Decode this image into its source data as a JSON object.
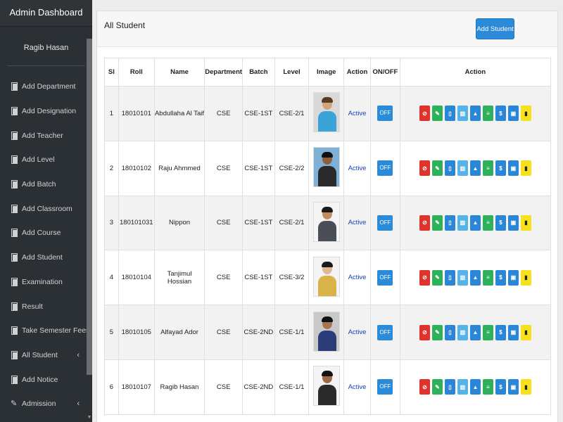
{
  "sidebar": {
    "title": "Admin Dashboard",
    "user": "Ragib Hasan",
    "items": [
      {
        "label": "Add Department",
        "icon": "doc-icon"
      },
      {
        "label": "Add Designation",
        "icon": "doc-icon"
      },
      {
        "label": "Add Teacher",
        "icon": "doc-icon"
      },
      {
        "label": "Add Level",
        "icon": "doc-icon"
      },
      {
        "label": "Add Batch",
        "icon": "doc-icon"
      },
      {
        "label": "Add Classroom",
        "icon": "doc-icon"
      },
      {
        "label": "Add Course",
        "icon": "doc-icon"
      },
      {
        "label": "Add Student",
        "icon": "doc-icon"
      },
      {
        "label": "Examination",
        "icon": "doc-icon"
      },
      {
        "label": "Result",
        "icon": "doc-icon"
      },
      {
        "label": "Take Semester Fees",
        "icon": "doc-icon"
      },
      {
        "label": "All Student",
        "icon": "doc-icon",
        "chevron": "‹"
      },
      {
        "label": "Add Notice",
        "icon": "doc-icon"
      },
      {
        "label": "Admission",
        "icon": "edit-icon",
        "chevron": "‹"
      }
    ]
  },
  "main": {
    "title": "All Student",
    "add_button": "Add Student"
  },
  "table": {
    "headers": [
      "Sl",
      "Roll",
      "Name",
      "Department",
      "Batch",
      "Level",
      "Image",
      "Action",
      "ON/OFF",
      "Action"
    ],
    "rows": [
      {
        "sl": "1",
        "roll": "18010101",
        "name": "Abdullaha Al Taif",
        "dept": "CSE",
        "batch": "CSE-1ST",
        "level": "CSE-2/1",
        "status": "Active",
        "toggle": "OFF"
      },
      {
        "sl": "2",
        "roll": "18010102",
        "name": "Raju Ahmmed",
        "dept": "CSE",
        "batch": "CSE-1ST",
        "level": "CSE-2/2",
        "status": "Active",
        "toggle": "OFF"
      },
      {
        "sl": "3",
        "roll": "180101031",
        "name": "Nippon",
        "dept": "CSE",
        "batch": "CSE-1ST",
        "level": "CSE-2/1",
        "status": "Active",
        "toggle": "OFF"
      },
      {
        "sl": "4",
        "roll": "18010104",
        "name": "Tanjimul Hossian",
        "dept": "CSE",
        "batch": "CSE-1ST",
        "level": "CSE-3/2",
        "status": "Active",
        "toggle": "OFF"
      },
      {
        "sl": "5",
        "roll": "18010105",
        "name": "Alfayad Ador",
        "dept": "CSE",
        "batch": "CSE-2ND",
        "level": "CSE-1/1",
        "status": "Active",
        "toggle": "OFF"
      },
      {
        "sl": "6",
        "roll": "18010107",
        "name": "Ragib Hasan",
        "dept": "CSE",
        "batch": "CSE-2ND",
        "level": "CSE-1/1",
        "status": "Active",
        "toggle": "OFF"
      }
    ],
    "action_buttons": [
      {
        "name": "reset-icon",
        "glyph": "⊘",
        "color": "#e0332c"
      },
      {
        "name": "edit-icon",
        "glyph": "✎",
        "color": "#2fb15b"
      },
      {
        "name": "mobile-icon",
        "glyph": "▯",
        "color": "#2a86d6"
      },
      {
        "name": "book-icon",
        "glyph": "▥",
        "color": "#56b3e8"
      },
      {
        "name": "graduation-cap-icon",
        "glyph": "▲",
        "color": "#2a86d6"
      },
      {
        "name": "list-icon",
        "glyph": "≡",
        "color": "#2fb15b"
      },
      {
        "name": "dollar-icon",
        "glyph": "$",
        "color": "#2a86d6"
      },
      {
        "name": "id-card-icon",
        "glyph": "▣",
        "color": "#2a86d6"
      },
      {
        "name": "trash-icon",
        "glyph": "▮",
        "color": "#f6e11c"
      }
    ]
  }
}
